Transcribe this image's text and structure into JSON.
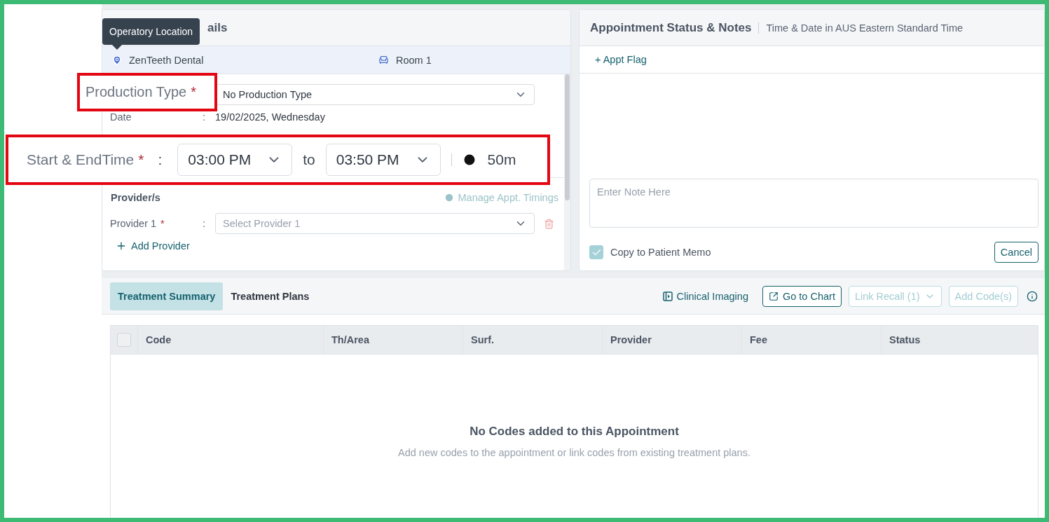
{
  "tooltip": {
    "text": "Operatory Location"
  },
  "details_panel": {
    "title": "ails",
    "location": "ZenTeeth Dental",
    "room": "Room 1",
    "production_type": {
      "value": "No Production Type"
    },
    "date": {
      "label": "Date",
      "separator": ":",
      "value": "19/02/2025, Wednesday"
    },
    "providers": {
      "title": "Provider/s",
      "manage_link": "Manage Appt. Timings",
      "rows": [
        {
          "label": "Provider 1",
          "required_mark": "*",
          "separator": ":",
          "placeholder": "Select Provider 1"
        }
      ],
      "add_button": "Add Provider"
    }
  },
  "notes_panel": {
    "title": "Appointment Status & Notes",
    "subtitle": "Time & Date in AUS Eastern Standard Time",
    "flag_button": "+ Appt Flag",
    "note": {
      "placeholder": "Enter Note Here"
    },
    "copy_to_memo": {
      "label": "Copy to Patient Memo",
      "checked": true
    },
    "cancel_button": "Cancel"
  },
  "treatment": {
    "tabs": [
      {
        "label": "Treatment Summary",
        "selected": true
      },
      {
        "label": "Treatment Plans",
        "selected": false
      }
    ],
    "actions": [
      {
        "label": "Clinical Imaging",
        "kind": "link",
        "disabled": false
      },
      {
        "label": "Go to Chart",
        "kind": "button",
        "disabled": false
      },
      {
        "label": "Link Recall (1)",
        "kind": "dropdown",
        "disabled": true
      },
      {
        "label": "Add Code(s)",
        "kind": "button",
        "disabled": true
      }
    ],
    "table": {
      "select_all": {
        "checked": false
      },
      "columns": [
        "Code",
        "Th/Area",
        "Surf.",
        "Provider",
        "Fee",
        "Status"
      ],
      "empty_title": "No Codes added to this Appointment",
      "empty_text": "Add new codes to the appointment or link codes from existing treatment plans."
    }
  },
  "callouts": [
    {
      "kind": "label",
      "label": "Production Type",
      "required_mark": "*"
    },
    {
      "kind": "time_range",
      "label": "Start & EndTime",
      "required_mark": "*",
      "separator": ":",
      "start": "03:00 PM",
      "joiner": "to",
      "end": "03:50 PM",
      "duration": "50m"
    }
  ]
}
